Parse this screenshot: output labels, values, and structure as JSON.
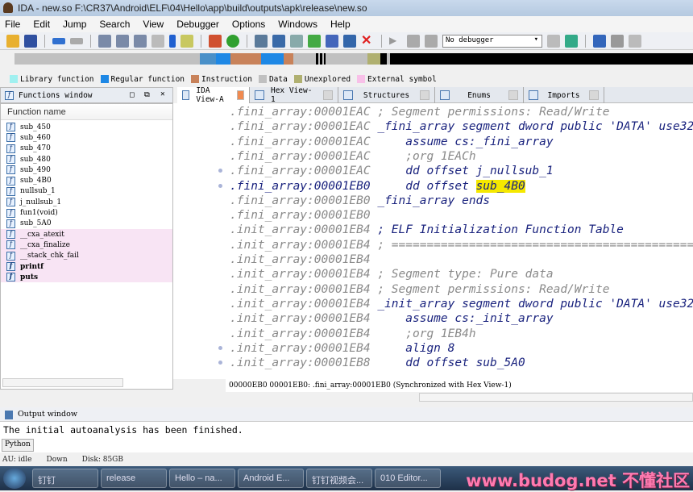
{
  "window": {
    "title": "IDA - new.so F:\\CR37\\Android\\ELF\\04\\Hello\\app\\build\\outputs\\apk\\release\\new.so"
  },
  "menu": [
    "File",
    "Edit",
    "Jump",
    "Search",
    "View",
    "Debugger",
    "Options",
    "Windows",
    "Help"
  ],
  "toolbar": {
    "debugger_select": "No debugger"
  },
  "legend": [
    {
      "label": "Library function",
      "color": "#a0f0f0"
    },
    {
      "label": "Regular function",
      "color": "#1e88e5"
    },
    {
      "label": "Instruction",
      "color": "#c8825a"
    },
    {
      "label": "Data",
      "color": "#c0c0c0"
    },
    {
      "label": "Unexplored",
      "color": "#b0b070"
    },
    {
      "label": "External symbol",
      "color": "#f8c0e8"
    }
  ],
  "functions_window": {
    "title": "Functions window",
    "column": "Function name",
    "items": [
      {
        "name": "sub_450",
        "kind": "regular"
      },
      {
        "name": "sub_460",
        "kind": "regular"
      },
      {
        "name": "sub_470",
        "kind": "regular"
      },
      {
        "name": "sub_480",
        "kind": "regular"
      },
      {
        "name": "sub_490",
        "kind": "regular"
      },
      {
        "name": "sub_4B0",
        "kind": "regular"
      },
      {
        "name": "nullsub_1",
        "kind": "regular"
      },
      {
        "name": "j_nullsub_1",
        "kind": "regular"
      },
      {
        "name": "fun1(void)",
        "kind": "regular"
      },
      {
        "name": "sub_5A0",
        "kind": "regular"
      },
      {
        "name": "__cxa_atexit",
        "kind": "external"
      },
      {
        "name": "__cxa_finalize",
        "kind": "external"
      },
      {
        "name": "__stack_chk_fail",
        "kind": "external"
      },
      {
        "name": "printf",
        "kind": "external-bold"
      },
      {
        "name": "puts",
        "kind": "external-bold"
      }
    ]
  },
  "tabs": [
    {
      "label": "IDA View-A",
      "active": true
    },
    {
      "label": "Hex View-1"
    },
    {
      "label": "Structures"
    },
    {
      "label": "Enums"
    },
    {
      "label": "Imports"
    }
  ],
  "disasm": [
    {
      "addr": ".fini_array:00001EAC",
      "pre": " ",
      "text": "; Segment permissions: Read/Write",
      "type": "cmt"
    },
    {
      "addr": ".fini_array:00001EAC",
      "pre": " ",
      "text": "_fini_array segment dword public 'DATA' use32",
      "type": "code"
    },
    {
      "addr": ".fini_array:00001EAC",
      "pre": "     ",
      "text": "assume cs:_fini_array",
      "type": "code"
    },
    {
      "addr": ".fini_array:00001EAC",
      "pre": "     ",
      "text": ";org 1EACh",
      "type": "cmt"
    },
    {
      "addr": ".fini_array:00001EAC",
      "pre": "     ",
      "text": "dd offset j_nullsub_1",
      "type": "code"
    },
    {
      "addr": ".fini_array:00001EB0",
      "pre": "     ",
      "text": "dd offset ",
      "hl": "sub_4B0",
      "type": "code",
      "current": true
    },
    {
      "addr": ".fini_array:00001EB0",
      "pre": " ",
      "text": "_fini_array ends",
      "type": "code"
    },
    {
      "addr": ".fini_array:00001EB0",
      "pre": "",
      "text": "",
      "type": "code"
    },
    {
      "addr": ".init_array:00001EB4",
      "pre": " ",
      "text": "; ELF Initialization Function Table",
      "type": "code"
    },
    {
      "addr": ".init_array:00001EB4",
      "pre": " ",
      "text": "; ===========================================================",
      "type": "cmt"
    },
    {
      "addr": ".init_array:00001EB4",
      "pre": "",
      "text": "",
      "type": "code"
    },
    {
      "addr": ".init_array:00001EB4",
      "pre": " ",
      "text": "; Segment type: Pure data",
      "type": "cmt"
    },
    {
      "addr": ".init_array:00001EB4",
      "pre": " ",
      "text": "; Segment permissions: Read/Write",
      "type": "cmt"
    },
    {
      "addr": ".init_array:00001EB4",
      "pre": " ",
      "text": "_init_array segment dword public 'DATA' use32",
      "type": "code"
    },
    {
      "addr": ".init_array:00001EB4",
      "pre": "     ",
      "text": "assume cs:_init_array",
      "type": "code"
    },
    {
      "addr": ".init_array:00001EB4",
      "pre": "     ",
      "text": ";org 1EB4h",
      "type": "cmt"
    },
    {
      "addr": ".init_array:00001EB4",
      "pre": "     ",
      "text": "align 8",
      "type": "code"
    },
    {
      "addr": ".init_array:00001EB8",
      "pre": "     ",
      "text": "dd offset sub_5A0",
      "type": "code"
    }
  ],
  "status_line": "00000EB0 00001EB0: .fini_array:00001EB0 (Synchronized with Hex View-1)",
  "output": {
    "title": "Output window",
    "text": "The initial autoanalysis has been finished.",
    "python_button": "Python"
  },
  "statusbar": {
    "au": "AU:  idle",
    "dir": "Down",
    "disk": "Disk: 85GB"
  },
  "taskbar": {
    "items": [
      "钉钉",
      "release",
      "Hello – na...",
      "Android E...",
      "钉钉视频会...",
      "010 Editor..."
    ],
    "watermark": "www.budog.net 不懂社区"
  }
}
